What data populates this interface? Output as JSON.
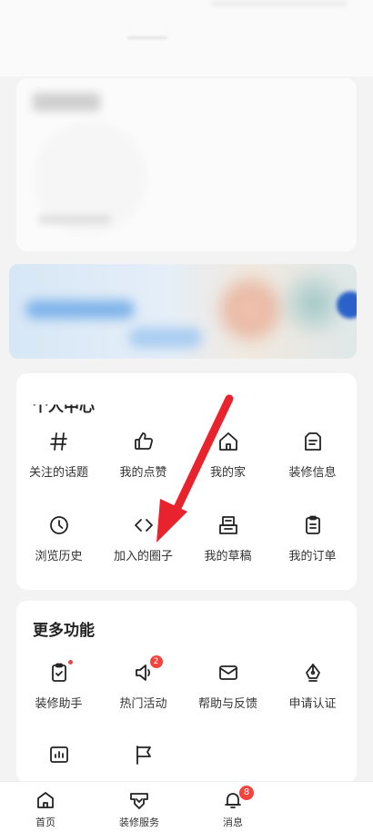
{
  "personal_center": {
    "title": "个人中心",
    "items": [
      {
        "label": "关注的话题",
        "icon": "hashtag-icon"
      },
      {
        "label": "我的点赞",
        "icon": "thumbs-up-icon"
      },
      {
        "label": "我的家",
        "icon": "home-icon"
      },
      {
        "label": "装修信息",
        "icon": "document-icon"
      },
      {
        "label": "浏览历史",
        "icon": "clock-icon"
      },
      {
        "label": "加入的圈子",
        "icon": "code-brackets-icon"
      },
      {
        "label": "我的草稿",
        "icon": "draft-tray-icon"
      },
      {
        "label": "我的订单",
        "icon": "clipboard-icon"
      }
    ]
  },
  "more_features": {
    "title": "更多功能",
    "items": [
      {
        "label": "装修助手",
        "icon": "clipboard-check-icon",
        "dot": true
      },
      {
        "label": "热门活动",
        "icon": "megaphone-icon",
        "badge": "2"
      },
      {
        "label": "帮助与反馈",
        "icon": "mail-icon"
      },
      {
        "label": "申请认证",
        "icon": "pen-nib-icon"
      },
      {
        "label": "",
        "icon": "bar-chart-icon"
      },
      {
        "label": "",
        "icon": "flag-icon"
      }
    ]
  },
  "tabbar": {
    "items": [
      {
        "label": "首页",
        "icon": "home-icon"
      },
      {
        "label": "装修服务",
        "icon": "service-icon"
      },
      {
        "label": "消息",
        "icon": "bell-icon",
        "badge": "8"
      }
    ]
  },
  "colors": {
    "badge": "#f4423d",
    "annotation_arrow": "#e8232e",
    "background": "#f3f3f4",
    "card": "#ffffff"
  }
}
